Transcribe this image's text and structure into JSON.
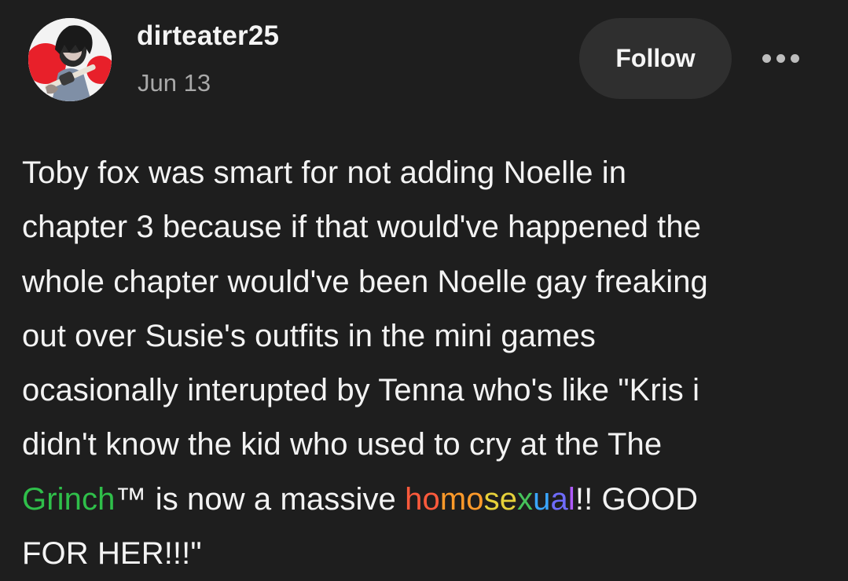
{
  "post": {
    "username": "dirteater25",
    "date": "Jun 13",
    "follow_label": "Follow",
    "more_icon": "ellipsis-icon",
    "avatar_icon": "user-avatar-image",
    "text_lines": [
      "Toby fox was smart for not adding Noelle in",
      "chapter 3 because if that would've happened the",
      "whole chapter would've been Noelle gay freaking",
      "out over Susie's outfits in the mini games",
      "ocasionally interupted by Tenna who's like \"Kris i",
      "didn't know the kid who used to cry at the The"
    ],
    "line7": {
      "green_word": "Grinch",
      "tm_text": "™ is now a massive ",
      "rainbow_parts": [
        "ho",
        "mo",
        "se",
        "x",
        "u",
        "a",
        "l"
      ],
      "after_rainbow": "!! GOOD"
    },
    "line8": "FOR HER!!!\""
  },
  "colors": {
    "background": "#1e1e1e",
    "text": "#f3f3f3",
    "muted": "#a9a9a9",
    "button_bg": "#2f2f2f",
    "green_text": "#2fbf4a"
  }
}
